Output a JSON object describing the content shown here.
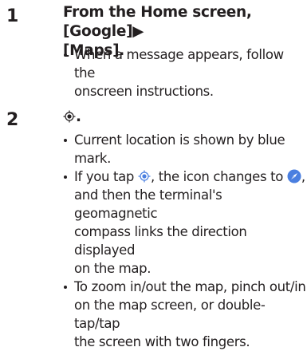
{
  "steps": [
    {
      "number": "1",
      "title_line1": "From the Home screen, [Google]▶",
      "title_line2": "[Maps].",
      "bullets": [
        {
          "line1": "When a message appears, follow the",
          "line2": "onscreen instructions."
        }
      ]
    },
    {
      "number": "2",
      "title_suffix": ".",
      "bullets": [
        {
          "line1": "Current location is shown by blue mark."
        },
        {
          "line1_a": "If you tap ",
          "line1_b": ", the icon changes to ",
          "line1_c": ",",
          "line2": "and then the terminal's geomagnetic",
          "line3": "compass links the direction displayed",
          "line4": "on the map."
        },
        {
          "line1": "To zoom in/out the map, pinch out/in",
          "line2": "on the map screen, or double-tap/tap",
          "line3": "the screen with two fingers."
        }
      ]
    }
  ],
  "icons": {
    "location": "my-location-icon",
    "compass": "compass-mode-icon",
    "accent_color": "#4a7fe0"
  }
}
